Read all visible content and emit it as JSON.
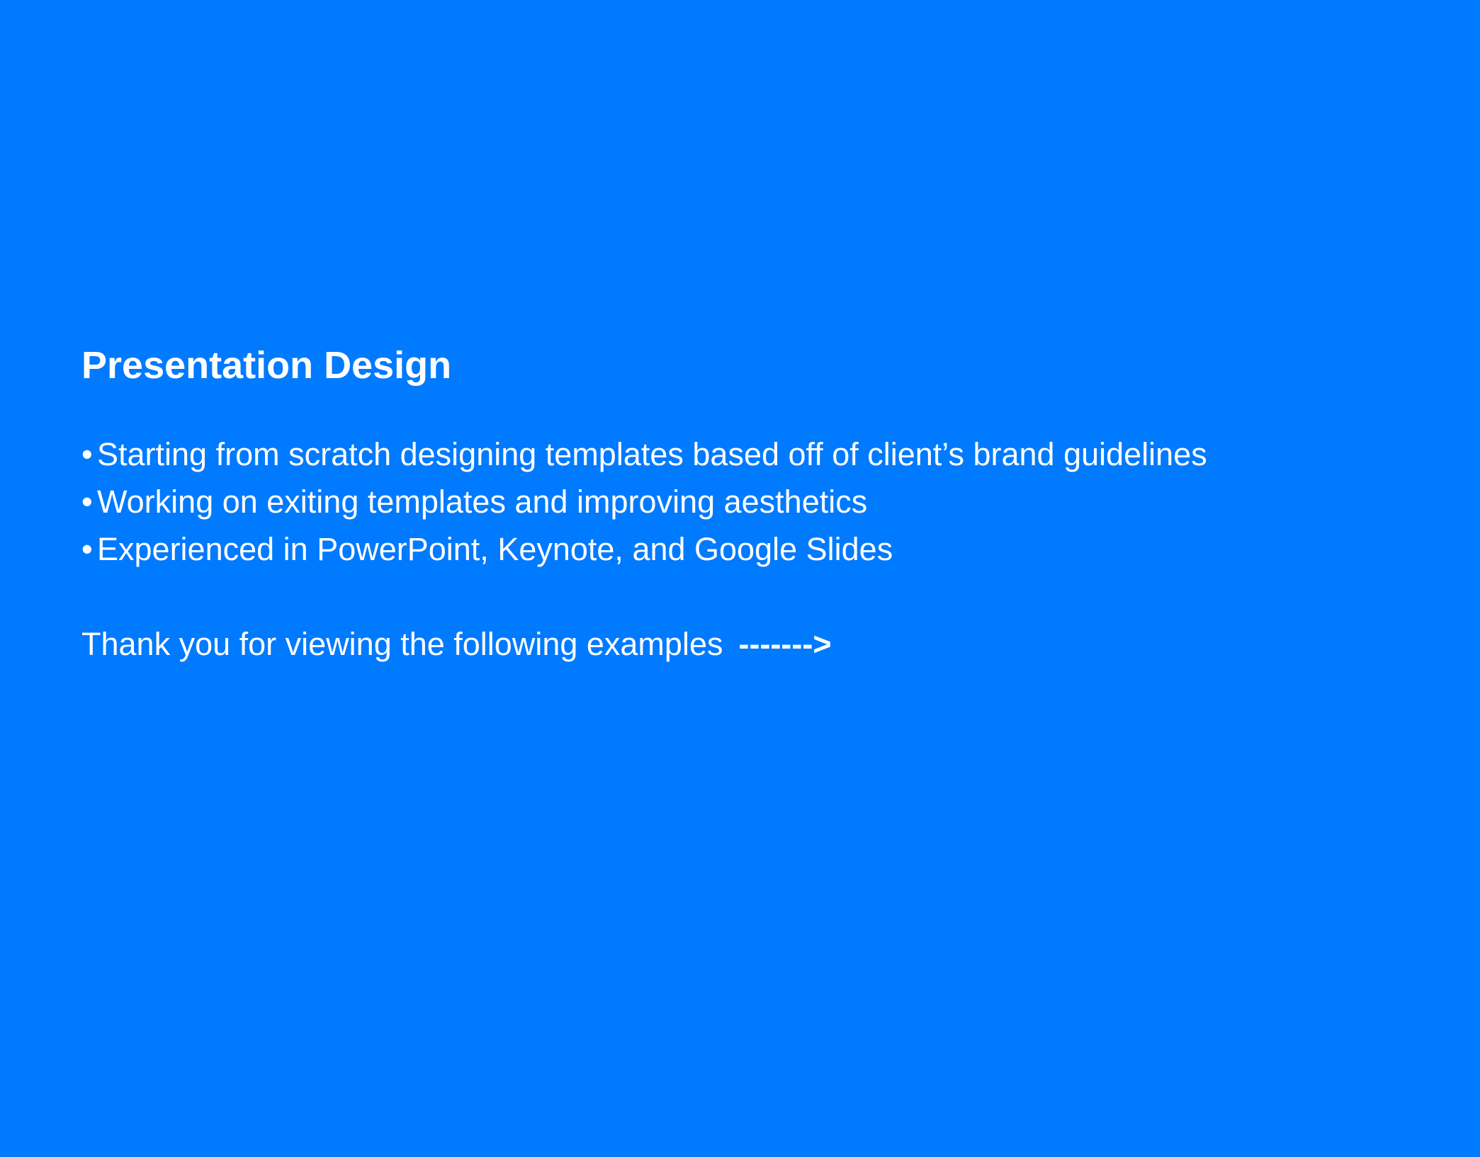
{
  "slide": {
    "background_color": "#007AFF",
    "text_color": "#FFFFFF",
    "title": "Presentation Design",
    "bullet_symbol": "•",
    "bullets": [
      "Starting from scratch designing templates based off of client’s brand guidelines",
      "Working on exiting templates and improving aesthetics",
      "Experienced in PowerPoint, Keynote, and Google Slides"
    ],
    "closing_text": "Thank you for viewing the following examples",
    "closing_arrow": "------->"
  }
}
